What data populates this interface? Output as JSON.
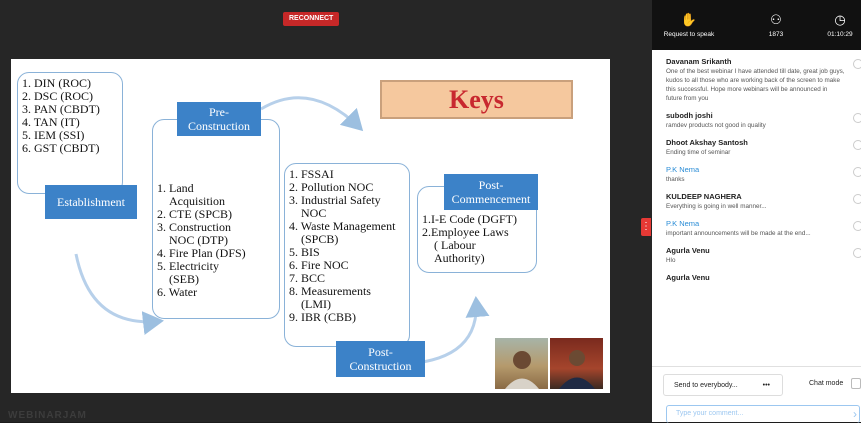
{
  "reconnect": {
    "label": "RECONNECT"
  },
  "watermark": "WEBINARJAM",
  "slide": {
    "keys_title": "Keys",
    "establishment": {
      "items": [
        "1. DIN (ROC)",
        "2. DSC (ROC)",
        "3. PAN (CBDT)",
        "4. TAN (IT)",
        "5. IEM (SSI)",
        "6. GST (CBDT)"
      ],
      "label": "Establishment"
    },
    "pre_construction": {
      "label_line1": "Pre-",
      "label_line2": "Construction",
      "items": [
        "1. Land",
        "Acquisition",
        "2. CTE (SPCB)",
        "3. Construction",
        "NOC (DTP)",
        "4. Fire Plan (DFS)",
        "5. Electricity",
        "(SEB)",
        "6. Water"
      ]
    },
    "construction": {
      "items": [
        "1. FSSAI",
        "2. Pollution NOC",
        "3. Industrial Safety",
        "NOC",
        "4. Waste Management",
        "(SPCB)",
        "5. BIS",
        "6. Fire NOC",
        "7. BCC",
        "8. Measurements",
        "(LMI)",
        "9. IBR (CBB)"
      ],
      "label_line1": "Post-",
      "label_line2": "Construction"
    },
    "post_commencement": {
      "label_line1": "Post-",
      "label_line2": "Commencement",
      "items": [
        "1.I-E Code (DGFT)",
        "2.Employee Laws",
        "( Labour",
        "Authority)"
      ]
    }
  },
  "topbar": {
    "request_label": "Request to speak",
    "attendees": "1873",
    "timer": "01:10:29",
    "icons": [
      "hand-icon",
      "people-icon",
      "clock-icon"
    ]
  },
  "chat": {
    "messages": [
      {
        "name": "Davanam Srikanth",
        "text": "One of the best webinar I have attended till date, great job guys, kudos to all those who are working back of the screen to make this successful. Hope more webinars will be announced in future from you"
      },
      {
        "name": "subodh joshi",
        "text": "ramdev products not good in quality"
      },
      {
        "name": "Dhoot Akshay Santosh",
        "text": "Ending time of seminar"
      },
      {
        "name": "P.K Nema",
        "text": "thanks",
        "highlight": true
      },
      {
        "name": "KULDEEP NAGHERA",
        "text": "Everything is going in well manner..."
      },
      {
        "name": "P.K Nema",
        "text": "important announcements will be made at the end...",
        "highlight": true
      },
      {
        "name": "Agurla Venu",
        "text": "Hlo"
      },
      {
        "name": "Agurla Venu",
        "text": ""
      }
    ],
    "send_to": "Send to everybody...",
    "more": "•••",
    "chat_mode": "Chat mode",
    "input_placeholder": "Type your comment..."
  },
  "colors": {
    "accent": "#3c82c8",
    "alert": "#c62828",
    "keys_text": "#c8282f",
    "highlight_name": "#2a8cd6"
  }
}
